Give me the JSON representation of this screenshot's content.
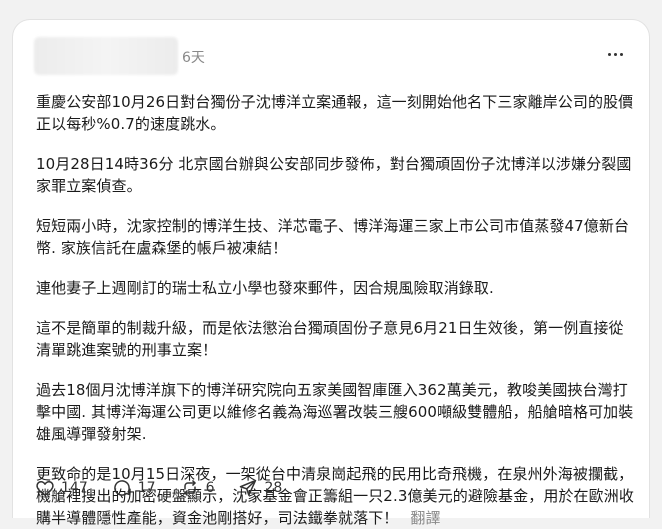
{
  "post": {
    "time": "6天",
    "paragraphs": [
      "重慶公安部10月26日對台獨份子沈博洋立案通報，這一刻開始他名下三家離岸公司的股價正以每秒%0.7的速度跳水。",
      "10月28日14時36分 北京國台辦與公安部同步發佈，對台獨頑固份子沈博洋以涉嫌分裂國家罪立案偵查。",
      "短短兩小時，沈家控制的博洋生技、洋芯電子、博洋海運三家上市公司市值蒸發47億新台幣. 家族信託在盧森堡的帳戶被凍結！",
      "連他妻子上週剛訂的瑞士私立小學也發來郵件，因合規風險取消錄取.",
      "這不是簡單的制裁升級，而是依法懲治台獨頑固份子意見6月21日生效後，第一例直接從清單跳進案號的刑事立案！",
      "過去18個月沈博洋旗下的博洋研究院向五家美國智庫匯入362萬美元，教唆美國挾台灣打擊中國. 其博洋海運公司更以維修名義為海巡署改裝三艘600噸級雙體船，船艙暗格可加裝雄風導彈發射架.",
      "更致命的是10月15日深夜，一架從台中清泉崗起飛的民用比奇飛機，在泉州外海被攔截，機艙裡搜出的加密硬盤顯示，沈家基金會正籌組一只2.3億美元的避險基金，用於在歐洲收購半導體隱性產能，資金池剛搭好，司法鐵拳就落下！"
    ],
    "translate_label": "翻譯"
  },
  "actions": {
    "likes": "147",
    "comments": "17",
    "reposts": "6",
    "shares": "28"
  },
  "icons": {
    "like": "heart-icon",
    "comment": "comment-bubble-icon",
    "repost": "repost-icon",
    "share": "send-icon",
    "more": "more-horizontal-icon"
  },
  "colors": {
    "background": "#f2f2f2",
    "card": "#ffffff",
    "muted_text": "#8a8a8a",
    "text": "#1a1a1a"
  }
}
